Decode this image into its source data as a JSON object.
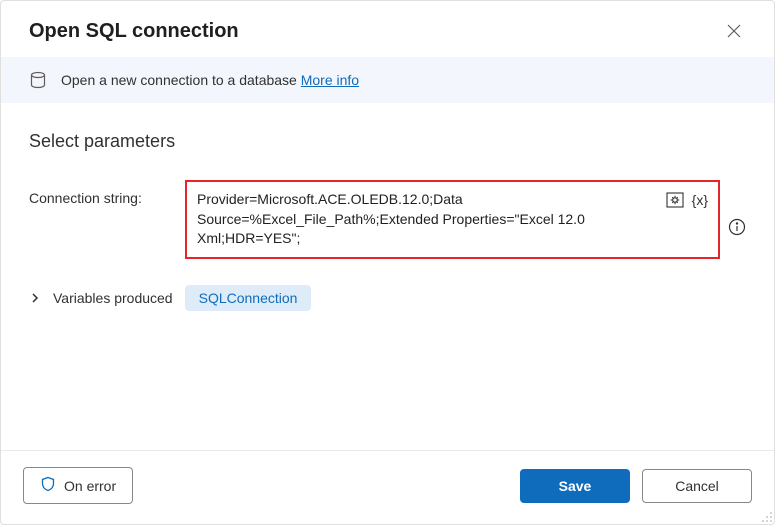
{
  "header": {
    "title": "Open SQL connection"
  },
  "banner": {
    "text": "Open a new connection to a database ",
    "more_info": "More info"
  },
  "section": {
    "title": "Select parameters"
  },
  "connection": {
    "label": "Connection string:",
    "value": "Provider=Microsoft.ACE.OLEDB.12.0;Data Source=%Excel_File_Path%;Extended Properties=\"Excel 12.0 Xml;HDR=YES\";",
    "var_symbol": "{x}"
  },
  "variables": {
    "label": "Variables produced",
    "items": [
      "SQLConnection"
    ]
  },
  "footer": {
    "on_error": "On error",
    "save": "Save",
    "cancel": "Cancel"
  }
}
